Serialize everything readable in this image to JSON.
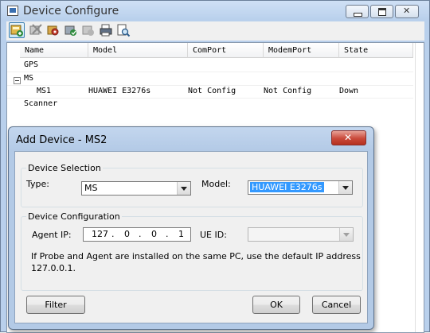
{
  "window": {
    "title": "Device Configure"
  },
  "toolbar": {
    "icons": [
      "add-device-icon",
      "remove-device-icon",
      "configure-device-icon",
      "connect-device-icon",
      "disconnect-device-icon",
      "print-icon",
      "find-icon"
    ]
  },
  "grid": {
    "columns": [
      "Name",
      "Model",
      "ComPort",
      "ModemPort",
      "State"
    ],
    "rows": [
      {
        "name": "GPS",
        "model": "",
        "comport": "",
        "modemport": "",
        "state": ""
      },
      {
        "name": "MS",
        "model": "",
        "comport": "",
        "modemport": "",
        "state": ""
      },
      {
        "name": "MS1",
        "model": "HUAWEI E3276s",
        "comport": "Not Config",
        "modemport": "Not Config",
        "state": "Down"
      },
      {
        "name": "Scanner",
        "model": "",
        "comport": "",
        "modemport": "",
        "state": ""
      }
    ]
  },
  "dialog": {
    "title": "Add Device - MS2",
    "device_selection": {
      "legend": "Device Selection",
      "type_label": "Type:",
      "type_value": "MS",
      "model_label": "Model:",
      "model_value": "HUAWEI E3276s"
    },
    "device_configuration": {
      "legend": "Device Configuration",
      "agent_ip_label": "Agent IP:",
      "ip": [
        "127",
        "0",
        "0",
        "1"
      ],
      "ue_id_label": "UE ID:",
      "ue_id_value": "",
      "note_line1": "If Probe and Agent are installed on the same PC, use the default IP address",
      "note_line2": "127.0.0.1."
    },
    "buttons": {
      "filter": "Filter",
      "ok": "OK",
      "cancel": "Cancel"
    }
  },
  "colors": {
    "title_bar": "#b9d0ec",
    "selection": "#3399ff",
    "close_button": "#c9493a"
  }
}
